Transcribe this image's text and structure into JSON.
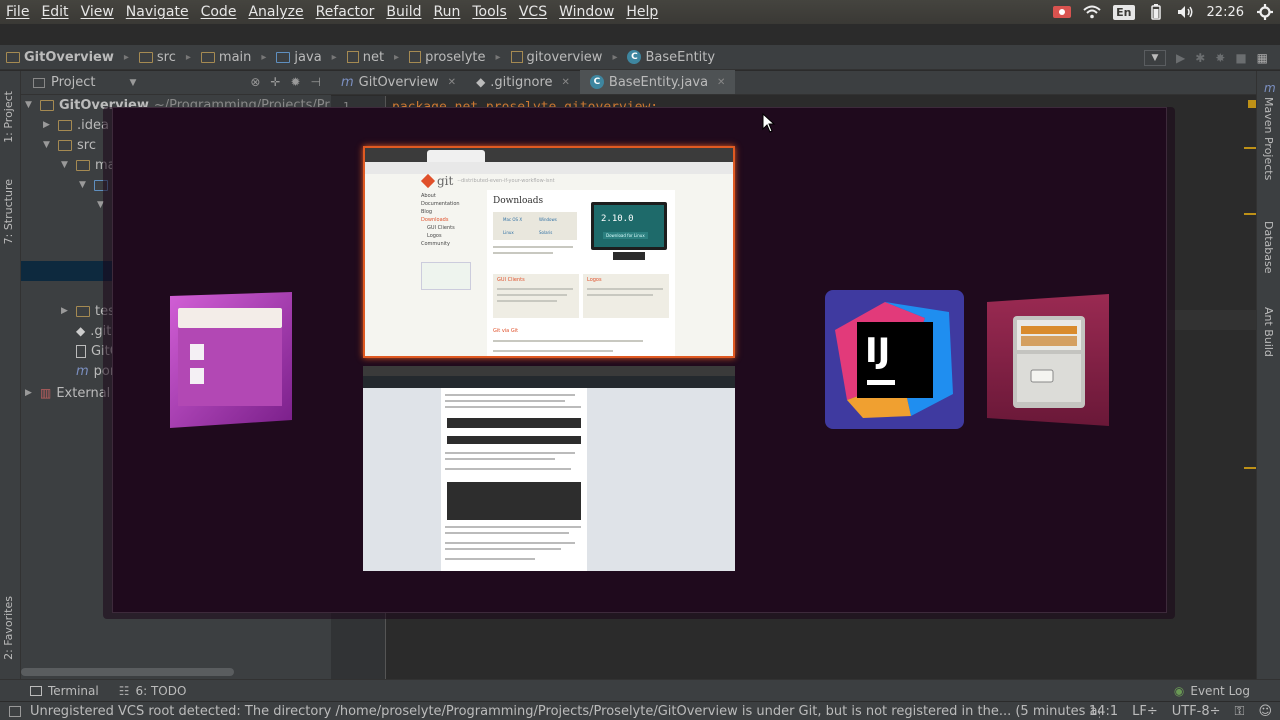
{
  "menubar": {
    "items": [
      "File",
      "Edit",
      "View",
      "Navigate",
      "Code",
      "Analyze",
      "Refactor",
      "Build",
      "Run",
      "Tools",
      "VCS",
      "Window",
      "Help"
    ],
    "keyboard_layout": "En",
    "clock": "22:26"
  },
  "navbar": {
    "crumbs": [
      "GitOverview",
      "src",
      "main",
      "java",
      "net",
      "proselyte",
      "gitoverview",
      "BaseEntity"
    ]
  },
  "left_strip": {
    "project_tab": "1: Project",
    "structure_tab": "7: Structure",
    "favorites_tab": "2: Favorites"
  },
  "project_panel": {
    "title": "Project",
    "tree": {
      "root": "GitOverview",
      "root_path": "~/Programming/Projects/Pr",
      "idea": ".idea",
      "src": "src",
      "main": "ma",
      "test": "tes",
      "gitignore": ".gitig",
      "iml": "GitOve",
      "pom": "pom.",
      "external": "External"
    }
  },
  "editor": {
    "tabs": [
      "GitOverview",
      ".gitignore",
      "BaseEntity.java"
    ],
    "line_number": "1",
    "code_line": "package net.proselyte.gitoverview;"
  },
  "right_strip": {
    "maven_tab": "Maven Projects",
    "database_tab": "Database",
    "ant_tab": "Ant Build"
  },
  "bottom_bar": {
    "terminal": "Terminal",
    "todo": "6: TODO",
    "event_log": "Event Log"
  },
  "status_bar": {
    "message": "Unregistered VCS root detected: The directory /home/proselyte/Programming/Projects/Proselyte/GitOverview is under Git, but is not registered in the... (5 minutes ago)",
    "position": "14:1",
    "line_sep": "LF÷",
    "encoding": "UTF-8÷"
  },
  "switcher": {
    "browser_preview": {
      "logo_text": "git",
      "tagline": "--distributed-even-if-your-workflow-isnt",
      "heading": "Downloads",
      "version_number": "2.10.0",
      "download_button": "Download for Linux",
      "gui_clients": "GUI Clients",
      "logos": "Logos",
      "git_via_git": "Git via Git",
      "sidebar_items": [
        "About",
        "Documentation",
        "Blog",
        "Downloads",
        "GUI Clients",
        "Logos",
        "Community"
      ],
      "os_options": [
        "Mac OS X",
        "Windows",
        "Linux",
        "Solaris"
      ]
    },
    "colors": {
      "highlight": "#e05a22",
      "overlay": "#1f0a1d",
      "intellij_bg": "#3f3aa0"
    },
    "app_icons": [
      "files-icon",
      "intellij-idea-icon",
      "file-cabinet-icon"
    ]
  }
}
